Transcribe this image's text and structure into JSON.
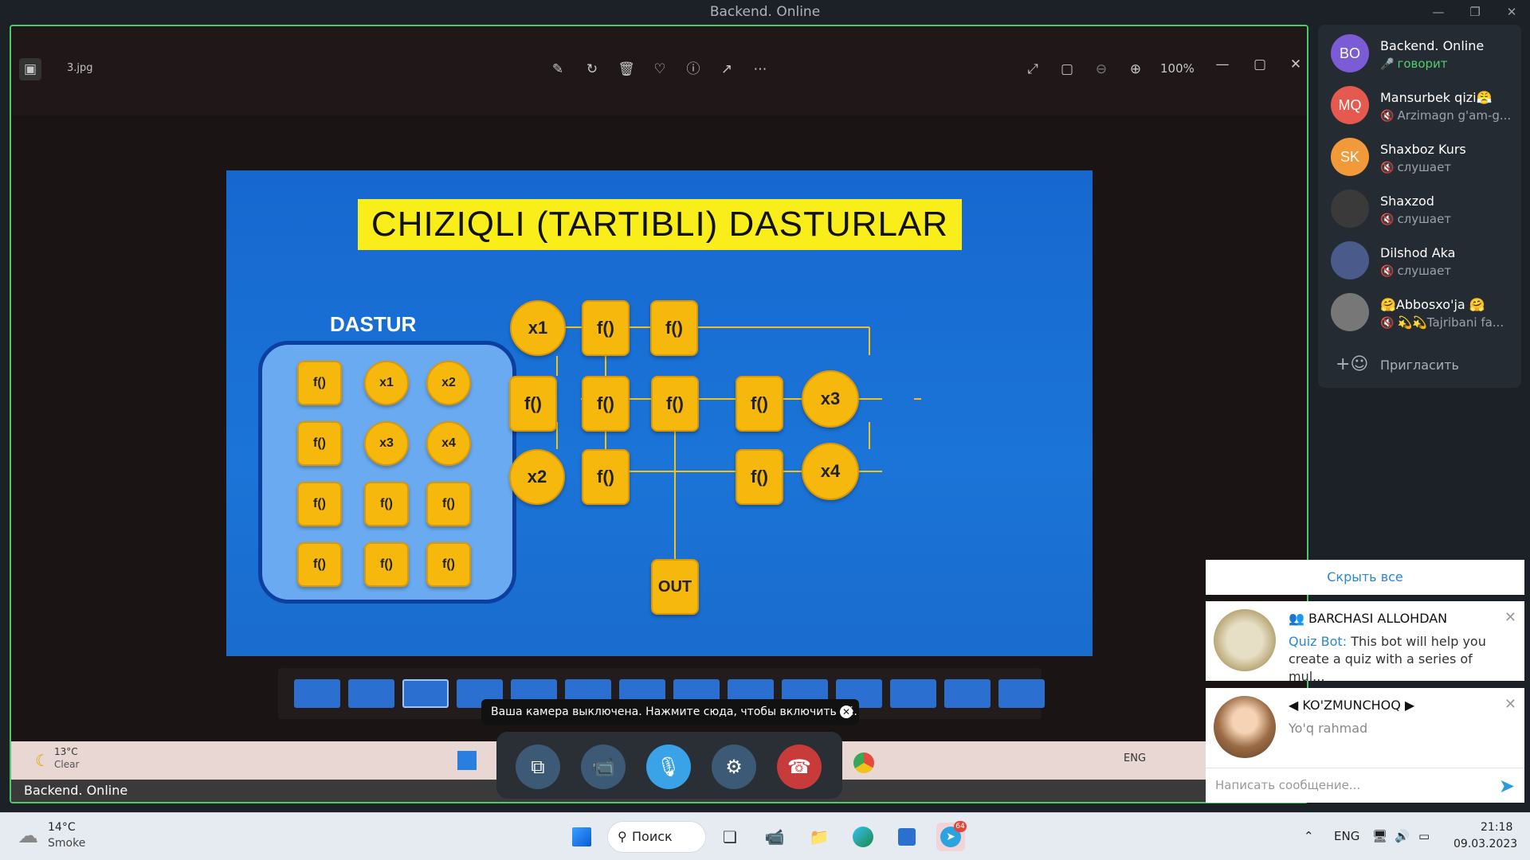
{
  "window": {
    "title": "Backend. Online"
  },
  "viewer": {
    "file_name": "3.jpg",
    "zoom": "100%"
  },
  "slide": {
    "title": "CHIZIQLI (TARTIBLI) DASTURLAR",
    "dastur_label": "DASTUR",
    "dastur_nodes": [
      {
        "label": "f()",
        "shape": "square"
      },
      {
        "label": "x1",
        "shape": "circle"
      },
      {
        "label": "x2",
        "shape": "circle"
      },
      {
        "label": "f()",
        "shape": "square"
      },
      {
        "label": "x3",
        "shape": "circle"
      },
      {
        "label": "x4",
        "shape": "circle"
      },
      {
        "label": "f()",
        "shape": "square"
      },
      {
        "label": "f()",
        "shape": "square"
      },
      {
        "label": "f()",
        "shape": "square"
      },
      {
        "label": "f()",
        "shape": "square"
      },
      {
        "label": "f()",
        "shape": "square"
      },
      {
        "label": "f()",
        "shape": "square"
      }
    ],
    "flow_nodes": {
      "x1": "x1",
      "x2": "x2",
      "x3": "x3",
      "x4": "x4",
      "f": "f()",
      "out": "OUT"
    }
  },
  "camera_tooltip": "Ваша камера выключена. Нажмите сюда, чтобы включить её.",
  "inner_screen": {
    "strip_title": "Backend. Online",
    "weather_temp": "13°C",
    "weather_desc": "Clear",
    "lang": "ENG"
  },
  "participants": [
    {
      "initials": "BO",
      "name": "Backend. Online",
      "status": "говорит",
      "color": "#7b5bd6",
      "speaking": true
    },
    {
      "initials": "MQ",
      "name": "Mansurbek qizi😤",
      "status": "Arzimagn g'am-g...",
      "color": "#e5594f",
      "speaking": false
    },
    {
      "initials": "SK",
      "name": "Shaxboz Kurs",
      "status": "слушает",
      "color": "#f29a3a",
      "speaking": false
    },
    {
      "initials": "",
      "name": "Shaxzod",
      "status": "слушает",
      "color": "#3a3a3a",
      "speaking": false
    },
    {
      "initials": "",
      "name": "Dilshod Aka",
      "status": "слушает",
      "color": "#4a5a8a",
      "speaking": false
    },
    {
      "initials": "",
      "name": "🤗Abbosxo'ja 🤗",
      "status": "💫💫Tajribani fa...",
      "color": "#777777",
      "speaking": false
    }
  ],
  "invite_label": "Пригласить",
  "notifications": {
    "hide_all": "Скрыть все",
    "items": [
      {
        "title": "BARCHASI ALLOHDAN",
        "sender": "Quiz Bot:",
        "text": "This bot will help you create a quiz with a series of mul..."
      },
      {
        "title": "◀ KO'ZMUNCHOQ ▶",
        "sender": "",
        "text": "Yo'q rahmad"
      }
    ]
  },
  "message_placeholder": "Написать сообщение...",
  "taskbar": {
    "weather_temp": "14°C",
    "weather_desc": "Smoke",
    "search_label": "Поиск",
    "lang": "ENG",
    "time": "21:18",
    "date": "09.03.2023",
    "telegram_badge": "64"
  },
  "colors": {
    "accent_green": "#4ec96a",
    "slide_blue": "#1a6fd0",
    "node_yellow": "#f6b80d",
    "title_yellow": "#f9ee1a",
    "end_call": "#c73b3b",
    "mic_active": "#3aa3e8"
  }
}
